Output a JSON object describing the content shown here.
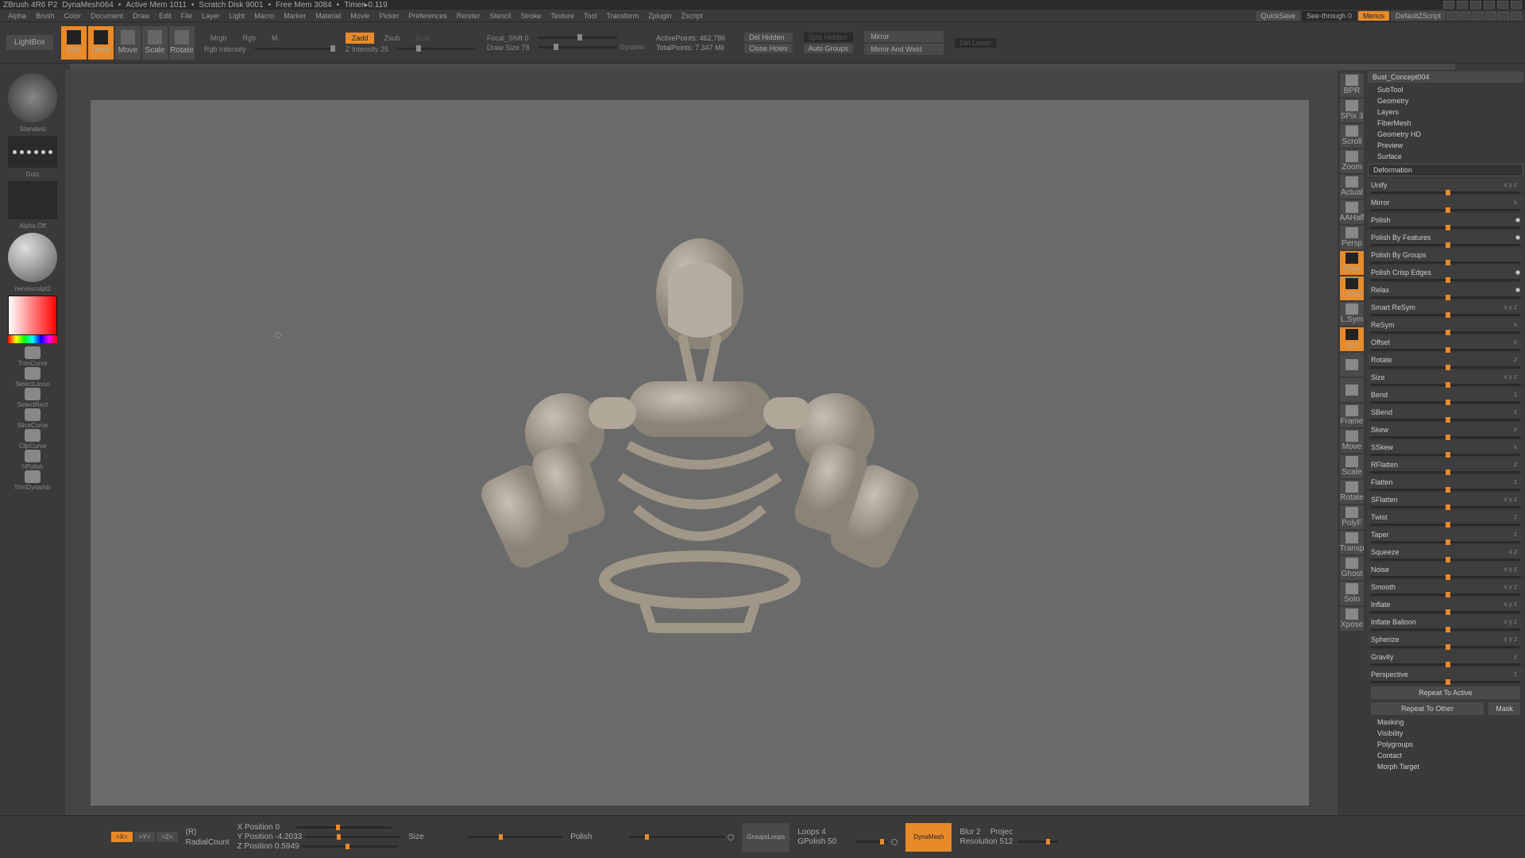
{
  "title": {
    "app": "ZBrush 4R6 P2",
    "doc": "DynaMesh064",
    "mem": "Active Mem 1011",
    "scratch": "Scratch Disk 9001",
    "free": "Free Mem 3084",
    "timer": "Timer▸0.119"
  },
  "menus": [
    "Alpha",
    "Brush",
    "Color",
    "Document",
    "Draw",
    "Edit",
    "File",
    "Layer",
    "Light",
    "Macro",
    "Marker",
    "Material",
    "Movie",
    "Picker",
    "Preferences",
    "Render",
    "Stencil",
    "Stroke",
    "Texture",
    "Tool",
    "Transform",
    "Zplugin",
    "Zscript"
  ],
  "topRight": {
    "quicksave": "QuickSave",
    "seethrough": "See-through   0",
    "menus": "Menus",
    "default": "DefaultZScript"
  },
  "toolbar": {
    "lightbox": "LightBox",
    "modes": [
      "Edit",
      "Draw",
      "Move",
      "Scale",
      "Rotate"
    ],
    "activeModes": [
      0,
      1
    ],
    "channels": {
      "mrgb": "Mrgb",
      "rgb": "Rgb",
      "m": "M",
      "rgbIntensity": "Rgb Intensity"
    },
    "zchannels": {
      "zadd": "Zadd",
      "zsub": "Zsub",
      "zcut": "Zcut",
      "zintensity": "Z Intensity 25"
    },
    "focal": "Focal_Shift 0",
    "drawsize": "Draw Size 78",
    "dynamic": "Dynamic",
    "activepoints": "ActivePoints: 462,786",
    "totalpoints": "TotalPoints: 7.347  Mil",
    "delhidden": "Del Hidden",
    "closeholes": "Close Holes",
    "splithidden": "Split Hidden",
    "autogroups": "Auto Groups",
    "mirror": "Mirror",
    "mirrorweld": "Mirror And Weld",
    "dellower": "Del Lower"
  },
  "leftPanel": {
    "brush": "Standard",
    "stroke": "Dots",
    "alpha": "Alpha  Off",
    "material": "nervesculpt2",
    "tools": [
      "TrimCurve",
      "SelectLasso",
      "SelectRect",
      "SliceCurve",
      "ClipCurve",
      "hPolish",
      "TrimDynamic"
    ]
  },
  "rightPanel": {
    "header": "Bust_Concept004",
    "sections": [
      "SubTool",
      "Geometry",
      "Layers",
      "FiberMesh",
      "Geometry HD",
      "Preview",
      "Surface"
    ],
    "deformationTitle": "Deformation",
    "defs": [
      {
        "n": "Unify",
        "a": "x y z"
      },
      {
        "n": "Mirror",
        "a": "x"
      },
      {
        "n": "Polish",
        "a": "",
        "dot": true
      },
      {
        "n": "Polish By Features",
        "a": "",
        "dot": true
      },
      {
        "n": "Polish By Groups",
        "a": ""
      },
      {
        "n": "Polish Crisp Edges",
        "a": "",
        "dot": true
      },
      {
        "n": "Relax",
        "a": "",
        "dot": true
      },
      {
        "n": "Smart ReSym",
        "a": "x y z"
      },
      {
        "n": "ReSym",
        "a": "x"
      },
      {
        "n": "Offset",
        "a": "x"
      },
      {
        "n": "Rotate",
        "a": "z"
      },
      {
        "n": "Size",
        "a": "x y z"
      },
      {
        "n": "Bend",
        "a": "z"
      },
      {
        "n": "SBend",
        "a": "z"
      },
      {
        "n": "Skew",
        "a": "x"
      },
      {
        "n": "SSkew",
        "a": "x"
      },
      {
        "n": "RFlatten",
        "a": "z"
      },
      {
        "n": "Flatten",
        "a": "z"
      },
      {
        "n": "SFlatten",
        "a": "x y z"
      },
      {
        "n": "Twist",
        "a": "z"
      },
      {
        "n": "Taper",
        "a": "z"
      },
      {
        "n": "Squeeze",
        "a": "x   z"
      },
      {
        "n": "Noise",
        "a": "x y z"
      },
      {
        "n": "Smooth",
        "a": "x y z"
      },
      {
        "n": "Inflate",
        "a": "x y z"
      },
      {
        "n": "Inflate Balloon",
        "a": "x y z"
      },
      {
        "n": "Spherize",
        "a": "x y z"
      },
      {
        "n": "Gravity",
        "a": "y"
      },
      {
        "n": "Perspective",
        "a": "z"
      }
    ],
    "repeatActive": "Repeat To Active",
    "repeatOther": "Repeat To Other",
    "mask": "Mask",
    "bottomSections": [
      "Masking",
      "Visibility",
      "Polygroups",
      "Contact",
      "Morph Target"
    ]
  },
  "rightTools": [
    "BPR",
    "SPix 3",
    "Scroll",
    "Zoom",
    "Actual",
    "AAHalf",
    "Persp",
    "Floor",
    "Local",
    "L.Sym",
    "xyz",
    "",
    "",
    "Frame",
    "Move",
    "Scale",
    "Rotate",
    "PolyF",
    "Transp",
    "Ghost",
    "Solo",
    "Xpose"
  ],
  "rtActive": [
    7,
    8,
    10
  ],
  "bottomBar": {
    "axes": [
      ">X<",
      ">Y<",
      ">Z<"
    ],
    "r": "(R)",
    "radial": "RadialCount",
    "pos": [
      {
        "l": "X Position 0",
        "v": 50
      },
      {
        "l": "Y Position -4.2033",
        "v": 40
      },
      {
        "l": "Z Position 0.5949",
        "v": 55
      }
    ],
    "sizeLbl": "Size",
    "polishLbl": "Polish",
    "groupsloops": "GroupsLoops",
    "loops": "Loops 4",
    "gpolish": "GPolish 50",
    "dynamesh": "DynaMesh",
    "blur": "Blur 2",
    "projec": "Projec",
    "resolution": "Resolution 512"
  }
}
